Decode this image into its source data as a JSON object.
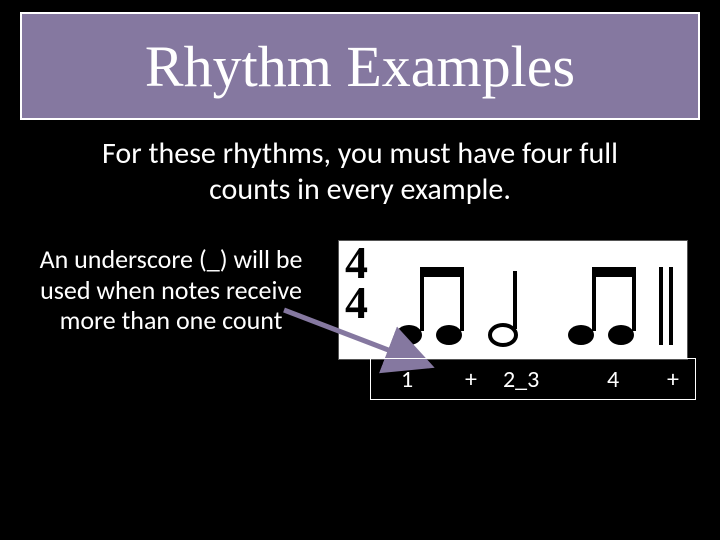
{
  "title": "Rhythm Examples",
  "subtitle": "For these rhythms, you must have four full counts in every example.",
  "left_text": "An underscore (_) will be used when notes receive more than one count",
  "time_signature": {
    "top": "4",
    "bottom": "4"
  },
  "counts": {
    "c1": "1",
    "c2": "+",
    "c3": "2_3",
    "c4": "4",
    "c5": "+"
  }
}
